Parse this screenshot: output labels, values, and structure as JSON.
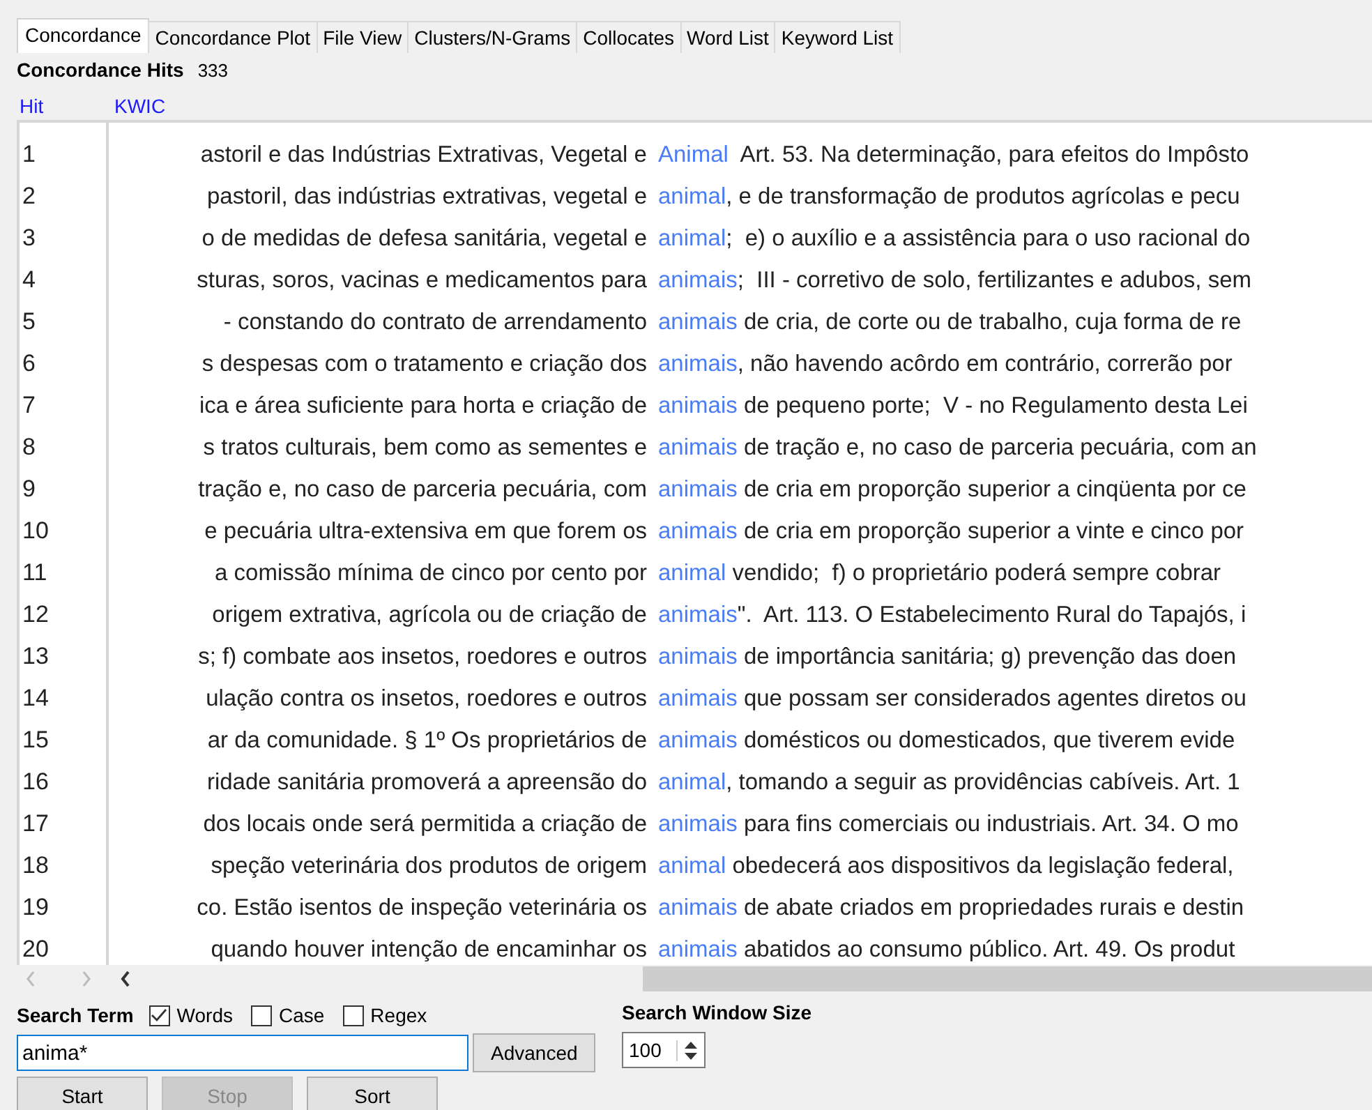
{
  "tabs": [
    {
      "label": "Concordance",
      "selected": true
    },
    {
      "label": "Concordance Plot",
      "selected": false
    },
    {
      "label": "File View",
      "selected": false
    },
    {
      "label": "Clusters/N-Grams",
      "selected": false
    },
    {
      "label": "Collocates",
      "selected": false
    },
    {
      "label": "Word List",
      "selected": false
    },
    {
      "label": "Keyword List",
      "selected": false
    }
  ],
  "hits": {
    "label": "Concordance Hits",
    "count": "333"
  },
  "columns": [
    "Hit",
    "KWIC"
  ],
  "rows": [
    {
      "hit": "1",
      "left": "astoril e das Indústrias Extrativas, Vegetal e",
      "keyword": "Animal",
      "right": "  Art. 53. Na determinação, para efeitos do Impôsto"
    },
    {
      "hit": "2",
      "left": "pastoril, das indústrias extrativas, vegetal e",
      "keyword": "animal",
      "right": ", e de transformação de produtos agrícolas e pecu"
    },
    {
      "hit": "3",
      "left": "o de medidas de defesa sanitária, vegetal e",
      "keyword": "animal",
      "right": ";  e) o auxílio e a assistência para o uso racional do"
    },
    {
      "hit": "4",
      "left": "sturas, soros, vacinas e medicamentos para",
      "keyword": "animais",
      "right": ";  III - corretivo de solo, fertilizantes e adubos, sem"
    },
    {
      "hit": "5",
      "left": "- constando do contrato de arrendamento",
      "keyword": "animais",
      "right": " de cria, de corte ou de trabalho, cuja forma de re"
    },
    {
      "hit": "6",
      "left": "s despesas com o tratamento e criação dos",
      "keyword": "animais",
      "right": ", não havendo acôrdo em contrário, correrão por"
    },
    {
      "hit": "7",
      "left": "ica e área suficiente para horta e criação de",
      "keyword": "animais",
      "right": " de pequeno porte;  V - no Regulamento desta Lei"
    },
    {
      "hit": "8",
      "left": "s tratos culturais, bem como as sementes e",
      "keyword": "animais",
      "right": " de tração e, no caso de parceria pecuária, com an"
    },
    {
      "hit": "9",
      "left": "tração e, no caso de parceria pecuária, com",
      "keyword": "animais",
      "right": " de cria em proporção superior a cinqüenta por ce"
    },
    {
      "hit": "10",
      "left": "e pecuária ultra-extensiva em que forem os",
      "keyword": "animais",
      "right": " de cria em proporção superior a vinte e cinco por"
    },
    {
      "hit": "11",
      "left": "a comissão mínima de cinco por cento por",
      "keyword": "animal",
      "right": " vendido;  f) o proprietário poderá sempre cobrar"
    },
    {
      "hit": "12",
      "left": "origem extrativa, agrícola ou de criação de",
      "keyword": "animais",
      "right": "\".  Art. 113. O Estabelecimento Rural do Tapajós, i"
    },
    {
      "hit": "13",
      "left": "s; f) combate aos insetos, roedores e outros",
      "keyword": "animais",
      "right": " de importância sanitária; g) prevenção das doen"
    },
    {
      "hit": "14",
      "left": "ulação contra os insetos, roedores e outros",
      "keyword": "animais",
      "right": " que possam ser considerados agentes diretos ou"
    },
    {
      "hit": "15",
      "left": "ar da comunidade. § 1º Os proprietários de",
      "keyword": "animais",
      "right": " domésticos ou domesticados, que tiverem evide"
    },
    {
      "hit": "16",
      "left": "ridade sanitária promoverá a apreensão do",
      "keyword": "animal",
      "right": ", tomando a seguir as providências cabíveis. Art. 1"
    },
    {
      "hit": "17",
      "left": "dos locais onde será permitida a criação de",
      "keyword": "animais",
      "right": " para fins comerciais ou industriais. Art. 34. O mo"
    },
    {
      "hit": "18",
      "left": "speção veterinária dos produtos de origem",
      "keyword": "animal",
      "right": " obedecerá aos dispositivos da legislação federal,"
    },
    {
      "hit": "19",
      "left": "co. Estão isentos de inspeção veterinária os",
      "keyword": "animais",
      "right": " de abate criados em propriedades rurais e destin"
    },
    {
      "hit": "20",
      "left": "quando houver intenção de encaminhar os",
      "keyword": "animais",
      "right": " abatidos ao consumo público. Art. 49. Os produt"
    }
  ],
  "search": {
    "label": "Search Term",
    "options": [
      {
        "label": "Words",
        "checked": true
      },
      {
        "label": "Case",
        "checked": false
      },
      {
        "label": "Regex",
        "checked": false
      }
    ],
    "value": "anima*",
    "advanced": "Advanced"
  },
  "window_size": {
    "label": "Search Window Size",
    "value": "100"
  },
  "buttons": [
    {
      "label": "Start",
      "disabled": false
    },
    {
      "label": "Stop",
      "disabled": true
    },
    {
      "label": "Sort",
      "disabled": false
    }
  ]
}
